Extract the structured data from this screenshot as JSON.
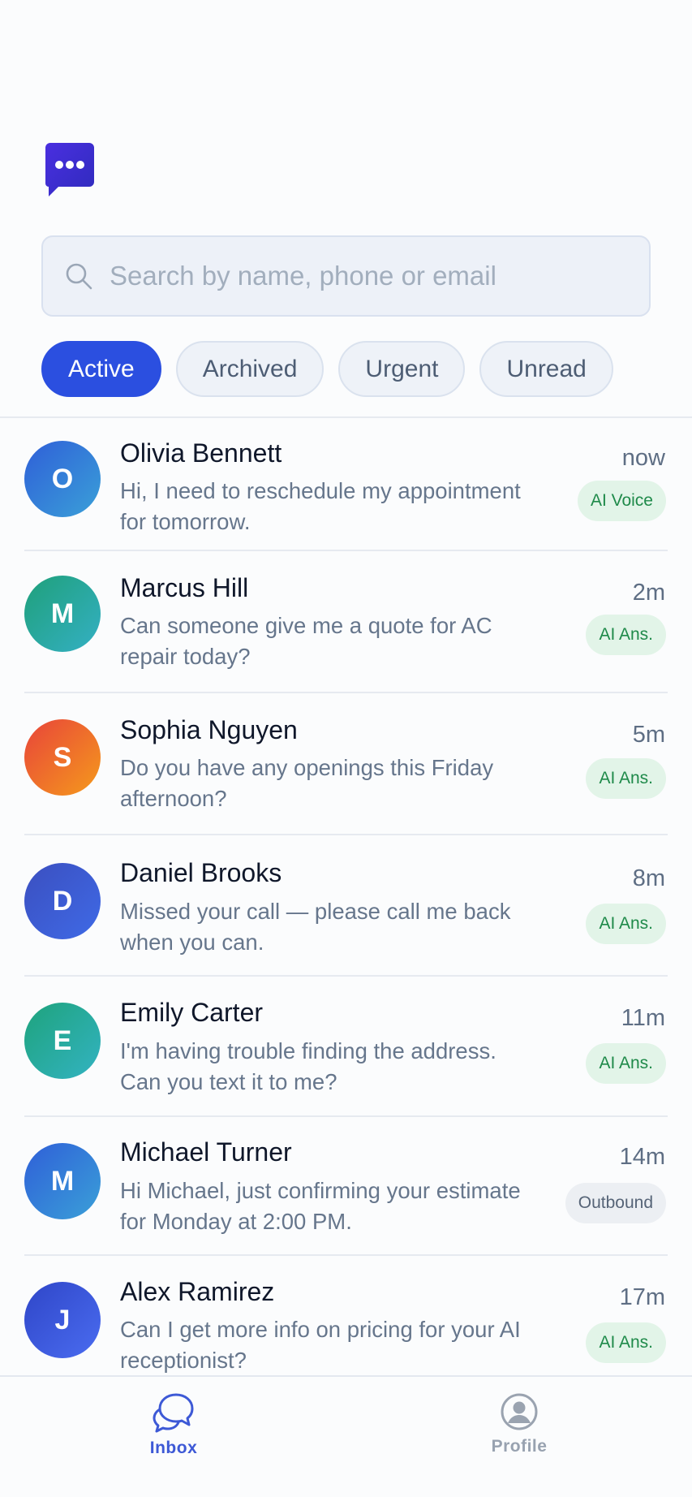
{
  "app": {
    "logo_icon": "chat-bubble-dots-icon",
    "brand_color": "#3b2bd6"
  },
  "search": {
    "placeholder": "Search by name, phone or email",
    "value": ""
  },
  "filters": [
    {
      "label": "Active",
      "active": true
    },
    {
      "label": "Archived",
      "active": false
    },
    {
      "label": "Urgent",
      "active": false
    },
    {
      "label": "Unread",
      "active": false
    }
  ],
  "conversations": [
    {
      "initial": "O",
      "name": "Olivia Bennett",
      "message": "Hi, I need to reschedule my appointment for tomorrow.",
      "time": "now",
      "badge": "AI Voice",
      "badge_type": "ai"
    },
    {
      "initial": "M",
      "name": "Marcus Hill",
      "message": "Can someone give me a quote for AC repair today?",
      "time": "2m",
      "badge": "AI Ans.",
      "badge_type": "ai"
    },
    {
      "initial": "S",
      "name": "Sophia Nguyen",
      "message": "Do you have any openings this Friday afternoon?",
      "time": "5m",
      "badge": "AI Ans.",
      "badge_type": "ai"
    },
    {
      "initial": "D",
      "name": "Daniel Brooks",
      "message": "Missed your call — please call me back when you can.",
      "time": "8m",
      "badge": "AI Ans.",
      "badge_type": "ai"
    },
    {
      "initial": "E",
      "name": "Emily Carter",
      "message": "I'm having trouble finding the address. Can you text it to me?",
      "time": "11m",
      "badge": "AI Ans.",
      "badge_type": "ai"
    },
    {
      "initial": "M",
      "name": "Michael Turner",
      "message": "Hi Michael, just confirming your estimate for Monday at 2:00 PM.",
      "time": "14m",
      "badge": "Outbound",
      "badge_type": "outbound"
    },
    {
      "initial": "J",
      "name": "Alex Ramirez",
      "message": "Can I get more info on pricing for your AI receptionist?",
      "time": "17m",
      "badge": "AI Ans.",
      "badge_type": "ai"
    }
  ],
  "avatar_colors": [
    [
      "#2f5fd8",
      "#3aa0d8"
    ],
    [
      "#1fa07a",
      "#34b0c4"
    ],
    [
      "#e8443a",
      "#f59a1c"
    ],
    [
      "#3b4fc0",
      "#3f6ae6"
    ],
    [
      "#1ea37c",
      "#33b3c2"
    ],
    [
      "#2f5fd8",
      "#3aa0d8"
    ],
    [
      "#2f46c8",
      "#4a6cf0"
    ]
  ],
  "tabs": {
    "inbox": {
      "label": "Inbox",
      "icon": "chat-bubbles-icon"
    },
    "profile": {
      "label": "Profile",
      "icon": "user-circle-icon"
    }
  }
}
